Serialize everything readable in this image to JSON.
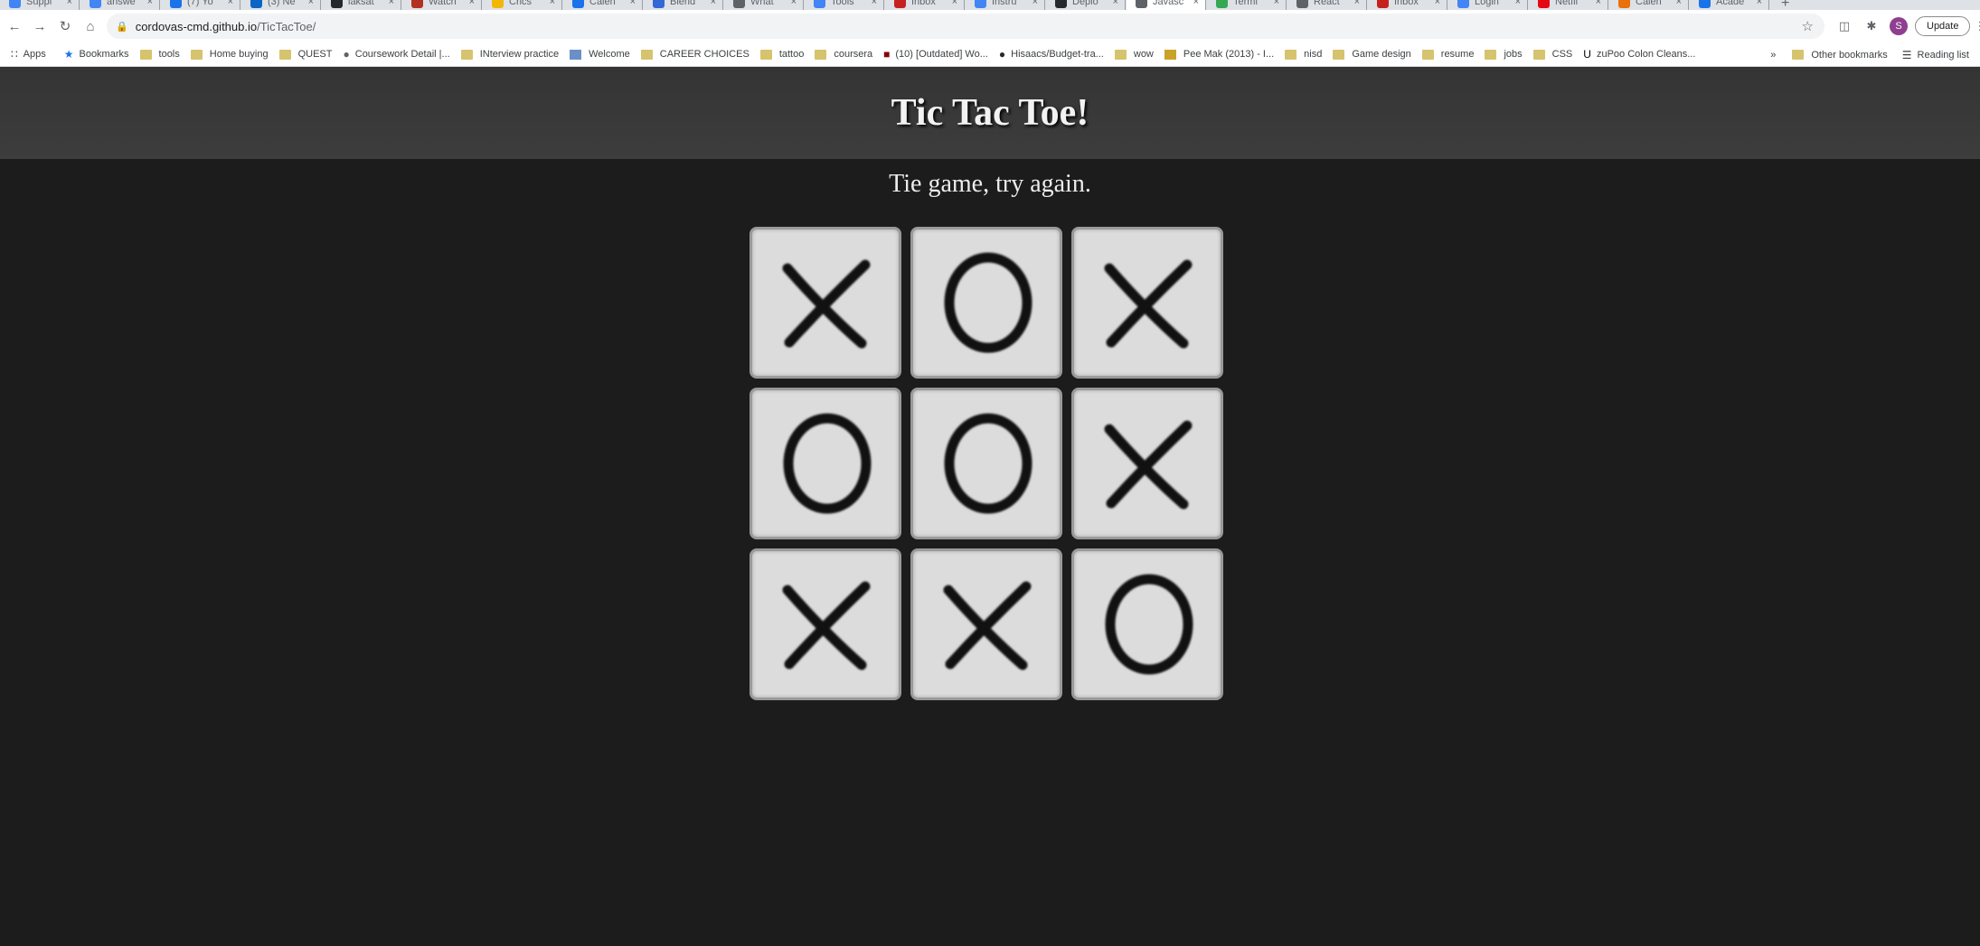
{
  "browser": {
    "tabs": [
      {
        "label": "Suppl",
        "favicon_color": "#4285f4"
      },
      {
        "label": "answe",
        "favicon_color": "#4285f4"
      },
      {
        "label": "(7) Yo",
        "favicon_color": "#1a73e8"
      },
      {
        "label": "(3) Ne",
        "favicon_color": "#0a66c2"
      },
      {
        "label": "iaksat",
        "favicon_color": "#24292e"
      },
      {
        "label": "Watch",
        "favicon_color": "#b23121"
      },
      {
        "label": "Crics",
        "favicon_color": "#f2b705"
      },
      {
        "label": "Calen",
        "favicon_color": "#1a73e8"
      },
      {
        "label": "Blend",
        "favicon_color": "#3367d6"
      },
      {
        "label": "What",
        "favicon_color": "#5f6368"
      },
      {
        "label": "Tools",
        "favicon_color": "#4285f4"
      },
      {
        "label": "Inbox",
        "favicon_color": "#c5221f"
      },
      {
        "label": "Instru",
        "favicon_color": "#4285f4"
      },
      {
        "label": "Deplo",
        "favicon_color": "#24292e"
      },
      {
        "label": "Javasc",
        "favicon_color": "#5f6368",
        "active": true
      },
      {
        "label": "Termi",
        "favicon_color": "#34a853"
      },
      {
        "label": "React",
        "favicon_color": "#5f6368"
      },
      {
        "label": "Inbox",
        "favicon_color": "#c5221f"
      },
      {
        "label": "Login",
        "favicon_color": "#4285f4"
      },
      {
        "label": "Netfli",
        "favicon_color": "#e50914"
      },
      {
        "label": "Calen",
        "favicon_color": "#e8710a"
      },
      {
        "label": "Acade",
        "favicon_color": "#1a73e8"
      }
    ],
    "url_host": "cordovas-cmd.github.io",
    "url_path": "/TicTacToe/",
    "update_label": "Update",
    "avatar_letter": "S"
  },
  "bookmarks": {
    "apps_label": "Apps",
    "items": [
      {
        "label": "Bookmarks",
        "type": "star"
      },
      {
        "label": "tools",
        "type": "folder"
      },
      {
        "label": "Home buying",
        "type": "folder"
      },
      {
        "label": "QUEST",
        "type": "folder"
      },
      {
        "label": "Coursework Detail |...",
        "type": "globe"
      },
      {
        "label": "INterview practice",
        "type": "folder"
      },
      {
        "label": "Welcome",
        "type": "site"
      },
      {
        "label": "CAREER CHOICES",
        "type": "folder"
      },
      {
        "label": "tattoo",
        "type": "folder"
      },
      {
        "label": "coursera",
        "type": "folder"
      },
      {
        "label": "(10) [Outdated] Wo...",
        "type": "youtube"
      },
      {
        "label": "Hisaacs/Budget-tra...",
        "type": "github"
      },
      {
        "label": "wow",
        "type": "folder"
      },
      {
        "label": "Pee Mak (2013) - I...",
        "type": "site2"
      },
      {
        "label": "nisd",
        "type": "folder"
      },
      {
        "label": "Game design",
        "type": "folder"
      },
      {
        "label": "resume",
        "type": "folder"
      },
      {
        "label": "jobs",
        "type": "folder"
      },
      {
        "label": "CSS",
        "type": "folder"
      },
      {
        "label": "zuPoo Colon Cleans...",
        "type": "u"
      }
    ],
    "more_label": "»",
    "other_label": "Other bookmarks",
    "reading_label": "Reading list"
  },
  "game": {
    "title": "Tic Tac Toe!",
    "status": "Tie game, try again.",
    "board": [
      "X",
      "O",
      "X",
      "O",
      "O",
      "X",
      "X",
      "X",
      "O"
    ]
  }
}
